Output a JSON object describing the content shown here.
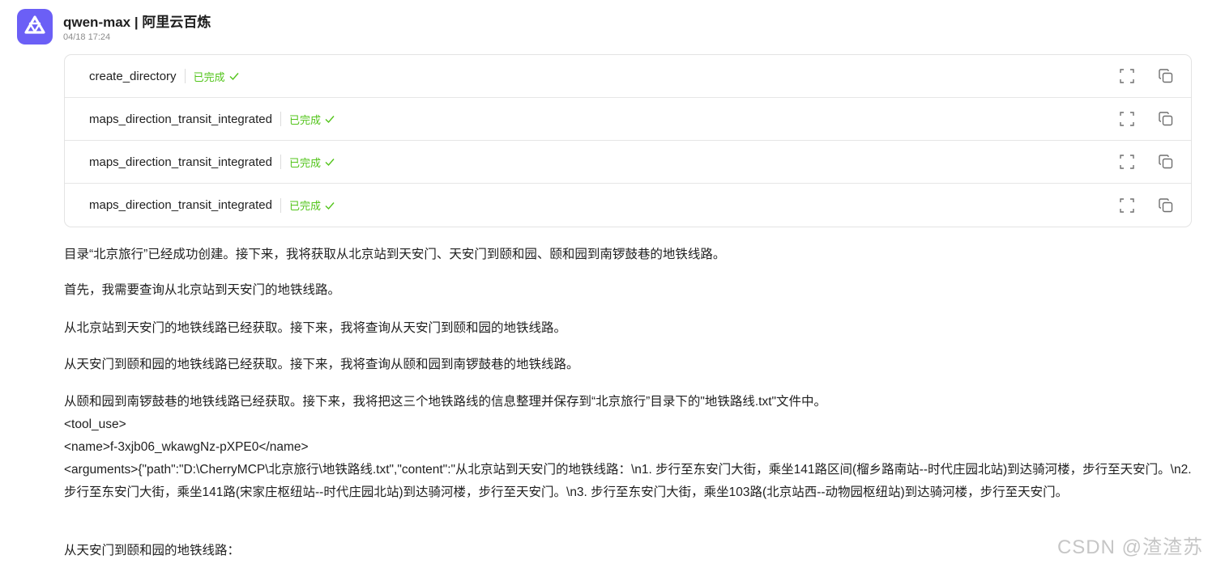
{
  "header": {
    "model_name": "qwen-max | 阿里云百炼",
    "timestamp": "04/18 17:24",
    "avatar_icon": "qwen-logo-icon",
    "avatar_color": "#6b5ff6"
  },
  "tool_calls": [
    {
      "name": "create_directory",
      "status": "已完成"
    },
    {
      "name": "maps_direction_transit_integrated",
      "status": "已完成"
    },
    {
      "name": "maps_direction_transit_integrated",
      "status": "已完成"
    },
    {
      "name": "maps_direction_transit_integrated",
      "status": "已完成"
    }
  ],
  "status_color": "#52c41a",
  "message": {
    "p1": "目录“北京旅行”已经成功创建。接下来，我将获取从北京站到天安门、天安门到颐和园、颐和园到南锣鼓巷的地铁线路。",
    "p2": "首先，我需要查询从北京站到天安门的地铁线路。",
    "p3": "从北京站到天安门的地铁线路已经获取。接下来，我将查询从天安门到颐和园的地铁线路。",
    "p4": "从天安门到颐和园的地铁线路已经获取。接下来，我将查询从颐和园到南锣鼓巷的地铁线路。",
    "p5_line1": "从颐和园到南锣鼓巷的地铁线路已经获取。接下来，我将把这三个地铁路线的信息整理并保存到“北京旅行”目录下的\"地铁路线.txt\"文件中。",
    "p5_line2": "<tool_use>",
    "p5_line3": "<name>f-3xjb06_wkawgNz-pXPE0</name>",
    "p5_line4": "<arguments>{\"path\":\"D:\\CherryMCP\\北京旅行\\地铁路线.txt\",\"content\":\"从北京站到天安门的地铁线路：\\n1. 步行至东安门大街，乘坐141路区间(榴乡路南站--时代庄园北站)到达骑河楼，步行至天安门。\\n2. 步行至东安门大街，乘坐141路(宋家庄枢纽站--时代庄园北站)到达骑河楼，步行至天安门。\\n3. 步行至东安门大街，乘坐103路(北京站西--动物园枢纽站)到达骑河楼，步行至天安门。",
    "p6": "从天安门到颐和园的地铁线路："
  },
  "watermark": "CSDN @渣渣苏"
}
